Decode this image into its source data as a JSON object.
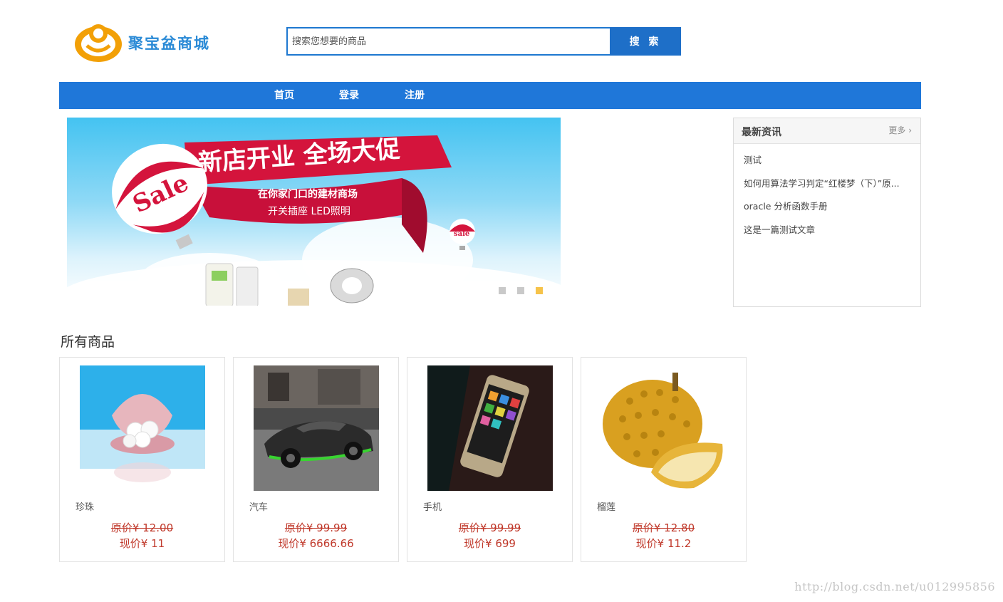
{
  "header": {
    "logo_text": "聚宝盆商城",
    "search_placeholder": "搜索您想要的商品",
    "search_button": "搜 索"
  },
  "nav": {
    "items": [
      {
        "label": "首页"
      },
      {
        "label": "登录"
      },
      {
        "label": "注册"
      }
    ]
  },
  "banner": {
    "ribbon_text": "新店开业 全场大促",
    "line1": "在你家门口的建材商场",
    "line2": "开关插座 LED照明",
    "balloon_text": "Sale",
    "small_balloon_text": "sale",
    "dots_count": 3,
    "active_dot": 3
  },
  "news": {
    "title": "最新资讯",
    "more": "更多",
    "items": [
      "测试",
      "如何用算法学习判定“红楼梦（下）”原...",
      "oracle 分析函数手册",
      "这是一篇测试文章"
    ]
  },
  "products": {
    "section_title": "所有商品",
    "items": [
      {
        "name": "珍珠",
        "old_price": "原价¥ 12.00",
        "new_price": "现价¥ 11",
        "icon": "pearl-image"
      },
      {
        "name": "汽车",
        "old_price": "原价¥ 99.99",
        "new_price": "现价¥ 6666.66",
        "icon": "car-image"
      },
      {
        "name": "手机",
        "old_price": "原价¥ 99.99",
        "new_price": "现价¥ 699",
        "icon": "phone-image"
      },
      {
        "name": "榴莲",
        "old_price": "原价¥ 12.80",
        "new_price": "现价¥ 11.2",
        "icon": "durian-image"
      }
    ]
  },
  "watermark": "http://blog.csdn.net/u012995856",
  "colors": {
    "nav_bg": "#1f77d9",
    "search_button": "#1e6fc8",
    "price": "#c0392b",
    "active_dot": "#f6c34a"
  }
}
